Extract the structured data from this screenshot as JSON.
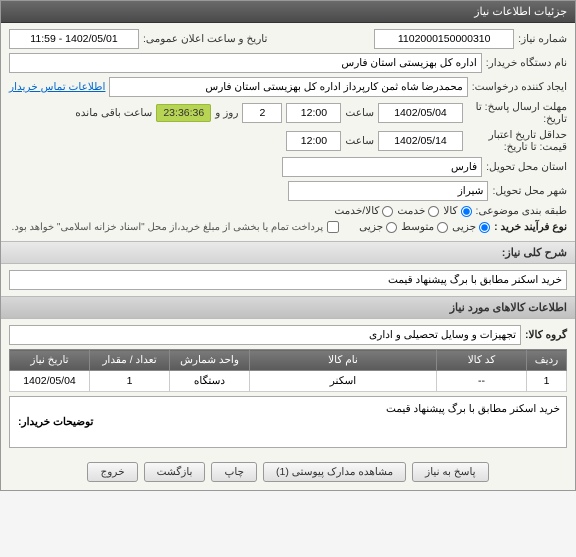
{
  "window": {
    "title": "جزئیات اطلاعات نیاز"
  },
  "form": {
    "needNumber": {
      "label": "شماره نیاز:",
      "value": "1102000150000310"
    },
    "announceDateTime": {
      "label": "تاریخ و ساعت اعلان عمومی:",
      "value": "1402/05/01 - 11:59"
    },
    "buyerOrg": {
      "label": "نام دستگاه خریدار:",
      "value": "اداره کل بهزیستی استان فارس"
    },
    "creator": {
      "label": "ایجاد کننده درخواست:",
      "value": "محمدرضا شاه ثمن کارپرداز اداره کل بهزیستی استان فارس"
    },
    "contactInfo": {
      "label": "اطلاعات تماس خریدار"
    },
    "deadline": {
      "label": "مهلت ارسال پاسخ: تا تاریخ:",
      "date": "1402/05/04",
      "timeWord1": "ساعت",
      "time": "12:00",
      "dayWord": "روز و",
      "days": "2",
      "remain": "23:36:36",
      "remainWord": "ساعت باقی مانده"
    },
    "minValid": {
      "label": "حداقل تاریخ اعتبار قیمت: تا تاریخ:",
      "date": "1402/05/14",
      "timeWord": "ساعت",
      "time": "12:00"
    },
    "province": {
      "label": "استان محل تحویل:",
      "value": "فارس"
    },
    "city": {
      "label": "شهر محل تحویل:",
      "value": "شیراز"
    },
    "category": {
      "label": "طبقه بندی موضوعی:",
      "kala": "کالا",
      "service": "خدمت",
      "both": "کالا/خدمت"
    },
    "buyType": {
      "label": "نوع فرآیند خرید :",
      "small": "جزیی",
      "medium": "متوسط",
      "large": "جزیی"
    },
    "paymentNote": "پرداخت تمام یا بخشی از مبلغ خرید،از محل \"اسناد خزانه اسلامی\" خواهد بود."
  },
  "sections": {
    "generalDesc": {
      "title": "شرح کلی نیاز:",
      "text": "خرید اسکنر مطابق با برگ پیشنهاد قیمت"
    },
    "itemsInfo": {
      "title": "اطلاعات کالاهای مورد نیاز"
    },
    "itemGroup": {
      "label": "گروه کالا:",
      "value": "تجهیزات و وسایل تحصیلی و اداری"
    }
  },
  "table": {
    "headers": {
      "row": "ردیف",
      "code": "کد کالا",
      "name": "نام کالا",
      "unit": "واحد شمارش",
      "qty": "تعداد / مقدار",
      "date": "تاریخ نیاز"
    },
    "rows": [
      {
        "row": "1",
        "code": "--",
        "name": "اسکنر",
        "unit": "دستگاه",
        "qty": "1",
        "date": "1402/05/04"
      }
    ]
  },
  "buyerNotes": {
    "label": "توضیحات خریدار:",
    "text": "خرید اسکنر مطابق با برگ پیشنهاد قیمت"
  },
  "buttons": {
    "respond": "پاسخ به نیاز",
    "attachments": "مشاهده مدارک پیوستی (1)",
    "print": "چاپ",
    "back": "بازگشت",
    "exit": "خروج"
  }
}
